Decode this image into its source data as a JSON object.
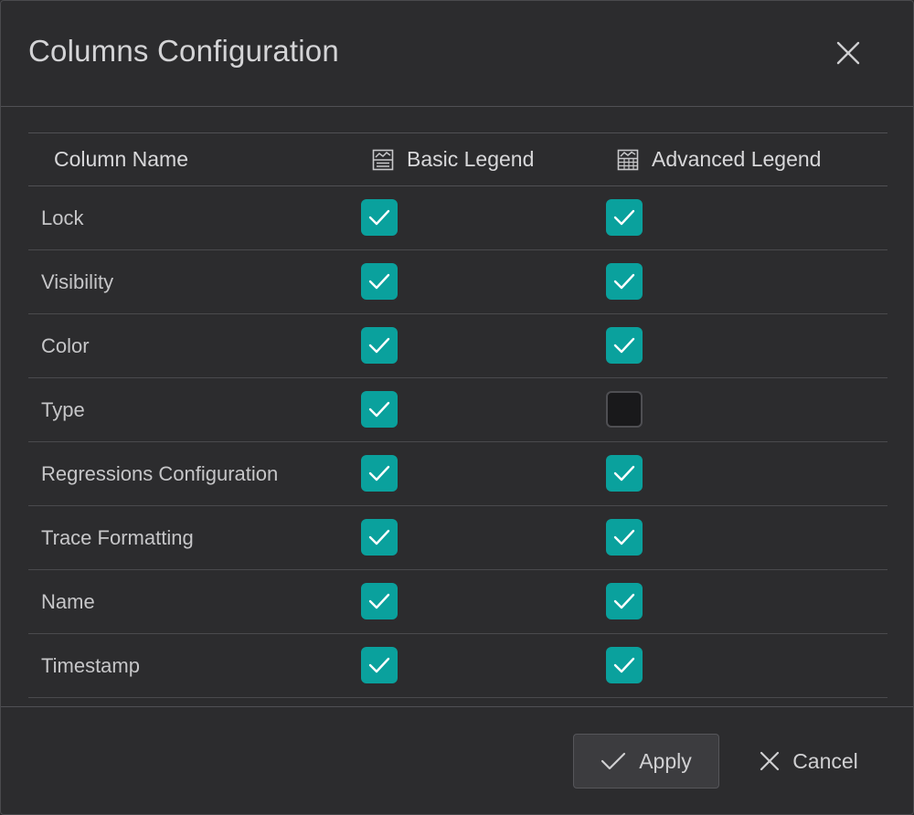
{
  "dialog": {
    "title": "Columns Configuration"
  },
  "table": {
    "headers": {
      "column_name": "Column Name",
      "basic_legend": "Basic Legend",
      "advanced_legend": "Advanced Legend"
    },
    "rows": [
      {
        "name": "Lock",
        "basic": true,
        "advanced": true
      },
      {
        "name": "Visibility",
        "basic": true,
        "advanced": true
      },
      {
        "name": "Color",
        "basic": true,
        "advanced": true
      },
      {
        "name": "Type",
        "basic": true,
        "advanced": false
      },
      {
        "name": "Regressions Configuration",
        "basic": true,
        "advanced": true
      },
      {
        "name": "Trace Formatting",
        "basic": true,
        "advanced": true
      },
      {
        "name": "Name",
        "basic": true,
        "advanced": true
      },
      {
        "name": "Timestamp",
        "basic": true,
        "advanced": true
      }
    ]
  },
  "footer": {
    "apply_label": "Apply",
    "cancel_label": "Cancel"
  },
  "colors": {
    "accent": "#0aa19d",
    "background": "#2c2c2e"
  },
  "icons": {
    "close": "close-icon",
    "basic_legend": "basic-legend-icon",
    "advanced_legend": "advanced-legend-icon",
    "apply": "check-icon",
    "cancel": "x-icon"
  }
}
